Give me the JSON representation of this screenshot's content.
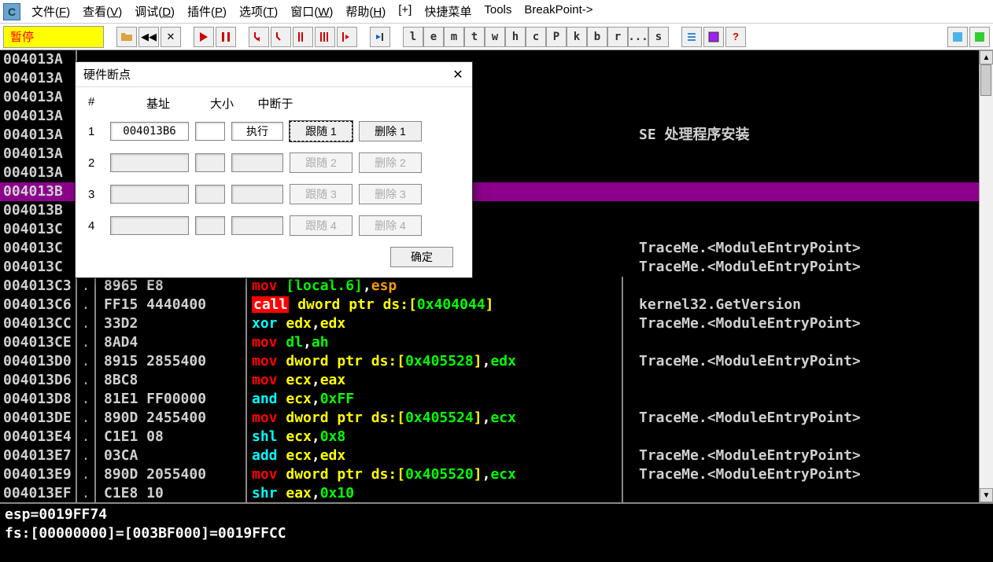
{
  "menu": {
    "items": [
      "文件(F)",
      "查看(V)",
      "调试(D)",
      "插件(P)",
      "选项(T)",
      "窗口(W)",
      "帮助(H)",
      "[+]",
      "快捷菜单",
      "Tools",
      "BreakPoint->"
    ]
  },
  "toolbar": {
    "pause_label": "暂停",
    "letters": [
      "l",
      "e",
      "m",
      "t",
      "w",
      "h",
      "c",
      "P",
      "k",
      "b",
      "r",
      "...",
      "s"
    ]
  },
  "dialog": {
    "title": "硬件断点",
    "headers": {
      "num": "#",
      "base": "基址",
      "size": "大小",
      "break": "中断于"
    },
    "rows": [
      {
        "num": "1",
        "base": "004013B6",
        "brk": "执行",
        "follow": "跟随 1",
        "del": "删除 1",
        "enabled": true,
        "focus": true
      },
      {
        "num": "2",
        "base": "",
        "brk": "",
        "follow": "跟随 2",
        "del": "删除 2",
        "enabled": false
      },
      {
        "num": "3",
        "base": "",
        "brk": "",
        "follow": "跟随 3",
        "del": "删除 3",
        "enabled": false
      },
      {
        "num": "4",
        "base": "",
        "brk": "",
        "follow": "跟随 4",
        "del": "删除 4",
        "enabled": false
      }
    ],
    "ok": "确定"
  },
  "disasm": {
    "rows": [
      {
        "addr": "004013A",
        "mark": "",
        "hex": "",
        "asm": [],
        "cmt": ""
      },
      {
        "addr": "004013A",
        "mark": "",
        "hex": "",
        "asm": [],
        "cmt": ""
      },
      {
        "addr": "004013A",
        "mark": "",
        "hex": "",
        "asm": [],
        "cmt": ""
      },
      {
        "addr": "004013A",
        "mark": "",
        "hex": "",
        "asm": [],
        "cmt": ""
      },
      {
        "addr": "004013A",
        "mark": "",
        "hex": "",
        "asm": [],
        "cmt": "SE 处理程序安装"
      },
      {
        "addr": "004013A",
        "mark": "",
        "hex": "",
        "asm": [],
        "cmt": ""
      },
      {
        "addr": "004013A",
        "mark": "",
        "hex": "",
        "asm": [],
        "cmt": ""
      },
      {
        "addr": "004013B",
        "mark": "",
        "hex": "",
        "asm": [],
        "cmt": "",
        "hl": true
      },
      {
        "addr": "004013B",
        "mark": "",
        "hex": "",
        "asm": [],
        "cmt": ""
      },
      {
        "addr": "004013C",
        "mark": "",
        "hex": "",
        "asm": [],
        "cmt": ""
      },
      {
        "addr": "004013C",
        "mark": "",
        "hex": "",
        "asm": [],
        "cmt": "TraceMe.<ModuleEntryPoint>"
      },
      {
        "addr": "004013C",
        "mark": "",
        "hex": "",
        "asm": [],
        "cmt": "TraceMe.<ModuleEntryPoint>"
      },
      {
        "addr": "004013C3",
        "mark": ".",
        "hex": "8965 E8",
        "asm": [
          [
            "mov ",
            "op-red"
          ],
          [
            "[local.6]",
            "op-green"
          ],
          [
            ",",
            "op-white"
          ],
          [
            "esp",
            "op-orange"
          ]
        ],
        "cmt": ""
      },
      {
        "addr": "004013C6",
        "mark": ".",
        "hex": "FF15 4440400",
        "asm": [
          [
            "call",
            "op-redhl"
          ],
          [
            " dword ptr ds:[",
            "op-yellow"
          ],
          [
            "0x404044",
            "op-green"
          ],
          [
            "]",
            "op-yellow"
          ]
        ],
        "cmt": "kernel32.GetVersion"
      },
      {
        "addr": "004013CC",
        "mark": ".",
        "hex": "33D2",
        "asm": [
          [
            "xor ",
            "op-cyan"
          ],
          [
            "edx",
            "op-yellow"
          ],
          [
            ",",
            "op-white"
          ],
          [
            "edx",
            "op-yellow"
          ]
        ],
        "cmt": "TraceMe.<ModuleEntryPoint>"
      },
      {
        "addr": "004013CE",
        "mark": ".",
        "hex": "8AD4",
        "asm": [
          [
            "mov ",
            "op-red"
          ],
          [
            "dl",
            "op-green"
          ],
          [
            ",",
            "op-white"
          ],
          [
            "ah",
            "op-green"
          ]
        ],
        "cmt": ""
      },
      {
        "addr": "004013D0",
        "mark": ".",
        "hex": "8915 2855400",
        "asm": [
          [
            "mov ",
            "op-red"
          ],
          [
            "dword ptr ds:[",
            "op-yellow"
          ],
          [
            "0x405528",
            "op-green"
          ],
          [
            "]",
            "op-yellow"
          ],
          [
            ",",
            "op-white"
          ],
          [
            "edx",
            "op-green"
          ]
        ],
        "cmt": "TraceMe.<ModuleEntryPoint>"
      },
      {
        "addr": "004013D6",
        "mark": ".",
        "hex": "8BC8",
        "asm": [
          [
            "mov ",
            "op-red"
          ],
          [
            "ecx",
            "op-yellow"
          ],
          [
            ",",
            "op-white"
          ],
          [
            "eax",
            "op-yellow"
          ]
        ],
        "cmt": ""
      },
      {
        "addr": "004013D8",
        "mark": ".",
        "hex": "81E1 FF00000",
        "asm": [
          [
            "and ",
            "op-cyan"
          ],
          [
            "ecx",
            "op-yellow"
          ],
          [
            ",",
            "op-white"
          ],
          [
            "0xFF",
            "op-green"
          ]
        ],
        "cmt": ""
      },
      {
        "addr": "004013DE",
        "mark": ".",
        "hex": "890D 2455400",
        "asm": [
          [
            "mov ",
            "op-red"
          ],
          [
            "dword ptr ds:[",
            "op-yellow"
          ],
          [
            "0x405524",
            "op-green"
          ],
          [
            "]",
            "op-yellow"
          ],
          [
            ",",
            "op-white"
          ],
          [
            "ecx",
            "op-green"
          ]
        ],
        "cmt": "TraceMe.<ModuleEntryPoint>"
      },
      {
        "addr": "004013E4",
        "mark": ".",
        "hex": "C1E1 08",
        "asm": [
          [
            "shl ",
            "op-cyan"
          ],
          [
            "ecx",
            "op-yellow"
          ],
          [
            ",",
            "op-white"
          ],
          [
            "0x8",
            "op-green"
          ]
        ],
        "cmt": ""
      },
      {
        "addr": "004013E7",
        "mark": ".",
        "hex": "03CA",
        "asm": [
          [
            "add ",
            "op-cyan"
          ],
          [
            "ecx",
            "op-yellow"
          ],
          [
            ",",
            "op-white"
          ],
          [
            "edx",
            "op-yellow"
          ]
        ],
        "cmt": "TraceMe.<ModuleEntryPoint>"
      },
      {
        "addr": "004013E9",
        "mark": ".",
        "hex": "890D 2055400",
        "asm": [
          [
            "mov ",
            "op-red"
          ],
          [
            "dword ptr ds:[",
            "op-yellow"
          ],
          [
            "0x405520",
            "op-green"
          ],
          [
            "]",
            "op-yellow"
          ],
          [
            ",",
            "op-white"
          ],
          [
            "ecx",
            "op-green"
          ]
        ],
        "cmt": "TraceMe.<ModuleEntryPoint>"
      },
      {
        "addr": "004013EF",
        "mark": ".",
        "hex": "C1E8 10",
        "asm": [
          [
            "shr ",
            "op-cyan"
          ],
          [
            "eax",
            "op-yellow"
          ],
          [
            ",",
            "op-white"
          ],
          [
            "0x10",
            "op-green"
          ]
        ],
        "cmt": ""
      }
    ]
  },
  "status": {
    "line1": "esp=0019FF74",
    "line2": "fs:[00000000]=[003BF000]=0019FFCC"
  }
}
